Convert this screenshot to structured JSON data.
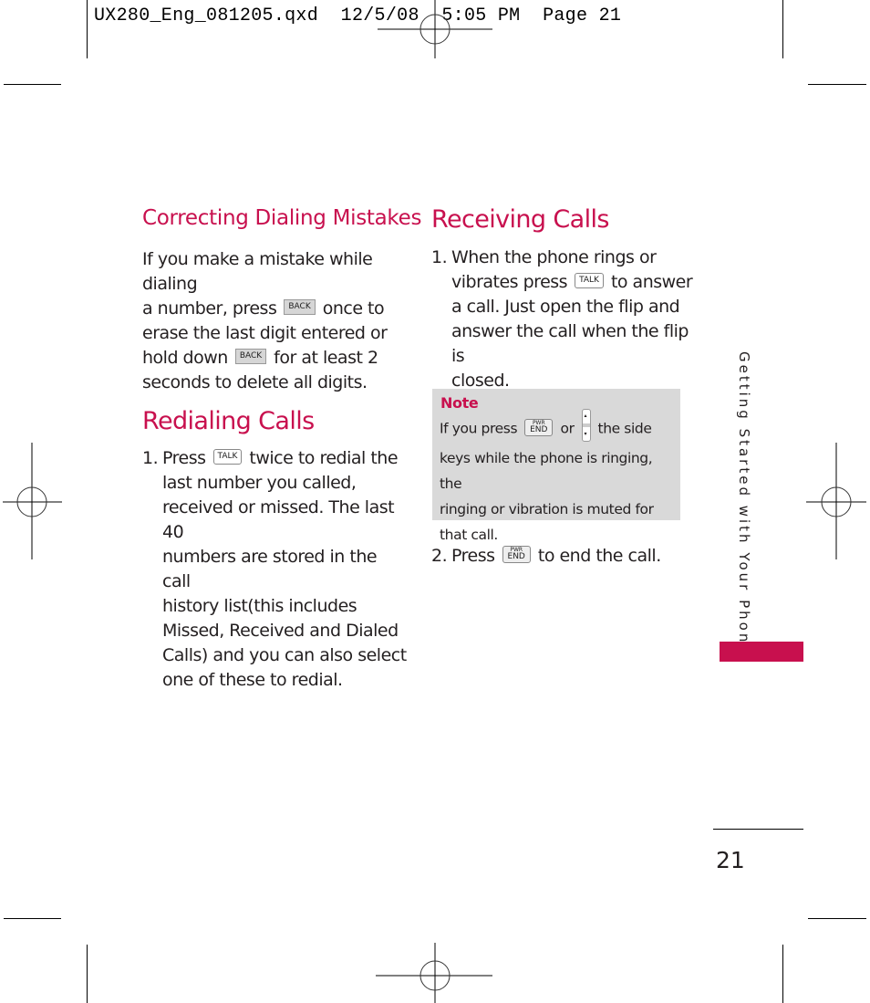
{
  "slug": "UX280_Eng_081205.qxd  12/5/08  5:05 PM  Page 21",
  "correcting": {
    "title": "Correcting Dialing Mistakes",
    "lines": [
      "If you make a mistake while dialing",
      "a number, press",
      "once to",
      "erase the last digit entered or",
      "hold down",
      "for at least 2",
      "seconds to delete all digits."
    ],
    "key": "BACK"
  },
  "redialing": {
    "title": "Redialing Calls",
    "num": "1.",
    "press": "Press",
    "key": "TALK",
    "line1_rest": "twice to redial the",
    "lines": [
      "last number you called,",
      "received or missed. The last 40",
      "numbers are stored in the call",
      "history list(this includes",
      "Missed, Received and Dialed",
      "Calls) and you can also select",
      "one of these to redial."
    ]
  },
  "receiving": {
    "title": "Receiving Calls",
    "step1": {
      "num": "1.",
      "line1": "When the phone rings or",
      "line2a": "vibrates press",
      "key": "TALK",
      "line2b": "to answer",
      "lines": [
        "a call. Just open the flip and",
        "answer the call when the flip is",
        "closed."
      ]
    },
    "note": {
      "title": "Note",
      "line1a": "If you press",
      "key_small": "PWR",
      "key_big": "END",
      "or": "or",
      "side_up": "▴",
      "side_down": "▾",
      "line1b": "the side",
      "lines": [
        "keys while the phone is ringing, the",
        "ringing or vibration is muted for",
        "that call."
      ]
    },
    "step2": {
      "num": "2.",
      "press": "Press",
      "key_small": "PWR",
      "key_big": "END",
      "rest": "to end the call."
    }
  },
  "side_tab": "Getting Started with Your Phone",
  "page_number": "21",
  "colors": {
    "accent": "#c8104e",
    "note_bg": "#d9d9d9"
  }
}
